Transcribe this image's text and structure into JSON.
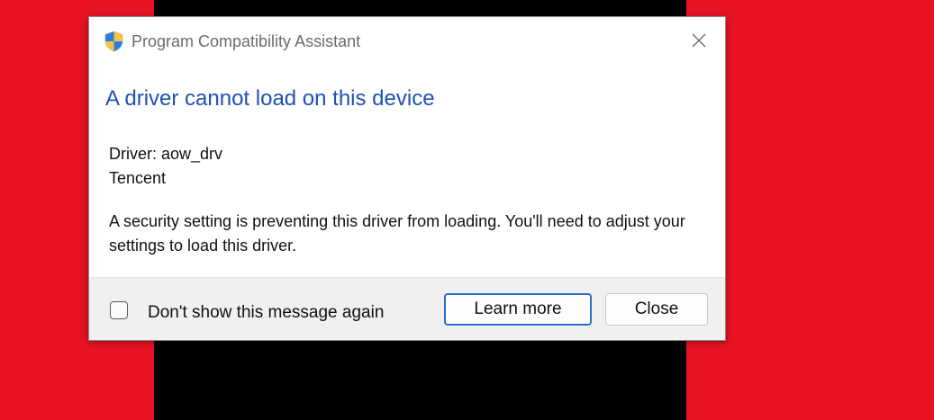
{
  "window": {
    "title": "Program Compatibility Assistant",
    "icon": "shield-icon",
    "close_icon": "close-icon"
  },
  "dialog": {
    "heading": "A driver cannot load on this device",
    "driver_line": "Driver: aow_drv",
    "vendor_line": "Tencent",
    "message": "A security setting is preventing this driver from loading. You'll need to adjust your settings to load this driver."
  },
  "footer": {
    "checkbox_label": "Don't show this message again",
    "checkbox_checked": false,
    "learn_more_label": "Learn more",
    "close_label": "Close"
  },
  "colors": {
    "background_red": "#e81224",
    "background_black": "#000000",
    "heading_blue": "#1f50b8",
    "focus_blue": "#2a6fd1"
  }
}
